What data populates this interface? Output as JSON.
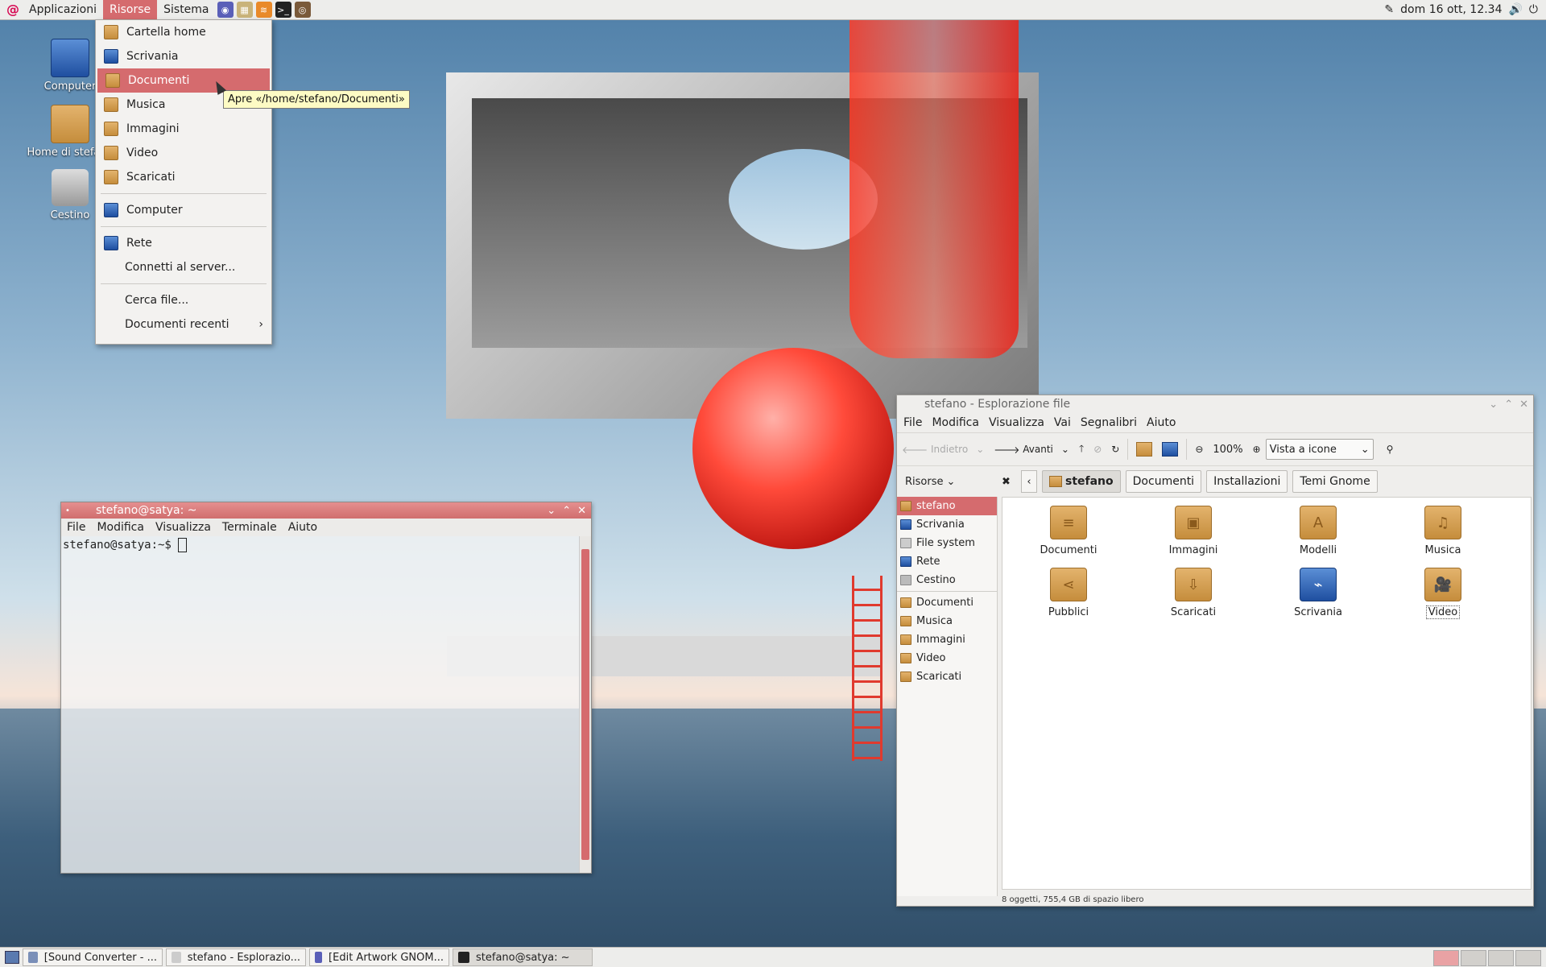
{
  "top_panel": {
    "menus": [
      "Applicazioni",
      "Risorse",
      "Sistema"
    ],
    "clock": "dom 16 ott, 12.34"
  },
  "desktop_icons": [
    "Computer",
    "Home di stefano",
    "Cestino"
  ],
  "places_menu": {
    "items": [
      "Cartella home",
      "Scrivania",
      "Documenti",
      "Musica",
      "Immagini",
      "Video",
      "Scaricati"
    ],
    "computer": "Computer",
    "network": [
      "Rete",
      "Connetti al server..."
    ],
    "search": [
      "Cerca file...",
      "Documenti recenti"
    ],
    "tooltip": "Apre «/home/stefano/Documenti»"
  },
  "terminal": {
    "title": "stefano@satya: ~",
    "menu": [
      "File",
      "Modifica",
      "Visualizza",
      "Terminale",
      "Aiuto"
    ],
    "prompt": "stefano@satya:~$ "
  },
  "file_manager": {
    "title": "stefano - Esplorazione file",
    "menu": [
      "File",
      "Modifica",
      "Visualizza",
      "Vai",
      "Segnalibri",
      "Aiuto"
    ],
    "toolbar": {
      "back": "Indietro",
      "forward": "Avanti",
      "zoom": "100%",
      "view": "Vista a icone"
    },
    "sidebar_title": "Risorse",
    "breadcrumbs": [
      "stefano",
      "Documenti",
      "Installazioni",
      "Temi Gnome"
    ],
    "sidebar_places": [
      "stefano",
      "Scrivania",
      "File system",
      "Rete",
      "Cestino"
    ],
    "sidebar_bookmarks": [
      "Documenti",
      "Musica",
      "Immagini",
      "Video",
      "Scaricati"
    ],
    "items": [
      "Documenti",
      "Immagini",
      "Modelli",
      "Musica",
      "Pubblici",
      "Scaricati",
      "Scrivania",
      "Video"
    ],
    "status": "8 oggetti, 755,4 GB di spazio libero"
  },
  "taskbar": {
    "tasks": [
      "[Sound Converter - ...",
      "stefano - Esplorazio...",
      "[Edit Artwork GNOM...",
      "stefano@satya: ~"
    ]
  },
  "colors": {
    "accent": "#d56b6e",
    "panel": "#ededeb",
    "folder": "#d6a257"
  }
}
